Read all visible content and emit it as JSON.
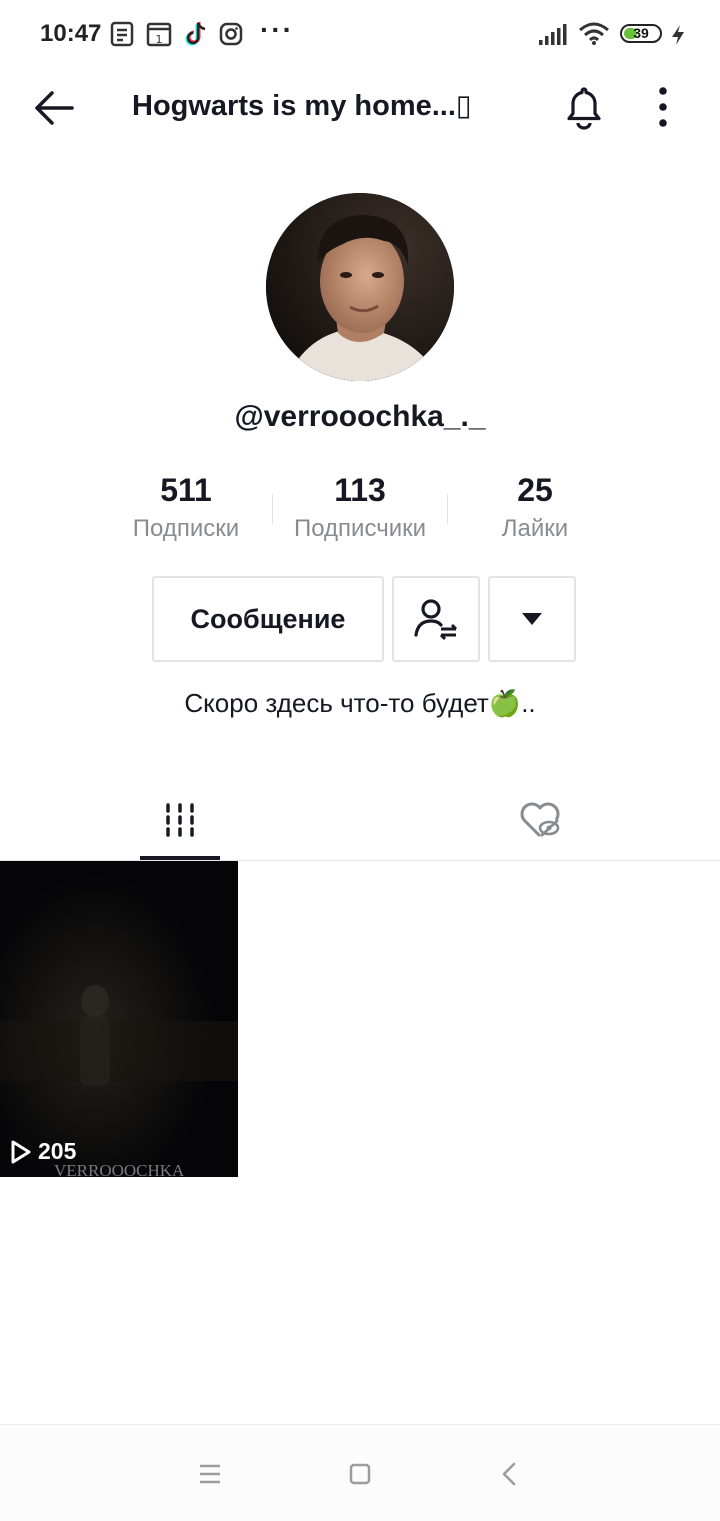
{
  "status_bar": {
    "time": "10:47",
    "battery": "39",
    "battery_level": 0.39,
    "icons": [
      "news-icon",
      "calendar-icon",
      "tiktok-icon",
      "instagram-icon",
      "more-dots-icon",
      "signal-icon",
      "wifi-icon",
      "battery-icon",
      "charging-icon"
    ]
  },
  "header": {
    "title": "Hogwarts is my home...▯",
    "icons": [
      "back-arrow-icon",
      "bell-icon",
      "more-vertical-icon"
    ]
  },
  "profile": {
    "username": "@verrooochka_._",
    "stats": [
      {
        "value": "511",
        "label": "Подписки"
      },
      {
        "value": "113",
        "label": "Подписчики"
      },
      {
        "value": "25",
        "label": "Лайки"
      }
    ],
    "message_button": "Сообщение",
    "bio": "Скоро здесь что-то будет🍏.."
  },
  "tabs": [
    {
      "icon": "grid-icon",
      "active": true
    },
    {
      "icon": "liked-hidden-icon",
      "active": false
    }
  ],
  "videos": [
    {
      "views": "205",
      "watermark": "VERROOOCHKA"
    }
  ],
  "nav_bar": {
    "icons": [
      "menu-icon",
      "home-icon",
      "back-icon"
    ]
  }
}
